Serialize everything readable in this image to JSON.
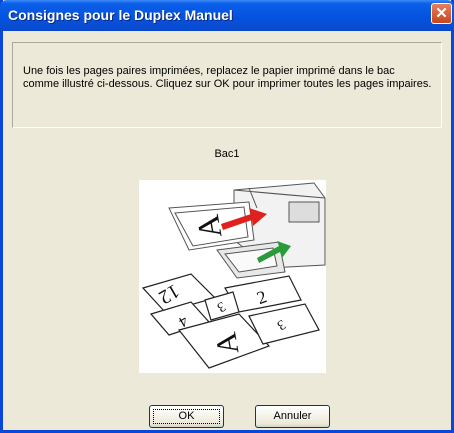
{
  "window": {
    "title": "Consignes pour le Duplex Manuel"
  },
  "message": "Une fois les pages paires imprimées, replacez le papier imprimé dans le bac comme illustré ci-dessous. Cliquez sur OK pour imprimer toutes les pages impaires.",
  "tray_label": "Bac1",
  "buttons": {
    "ok": "OK",
    "cancel": "Annuler"
  },
  "illustration": {
    "page_labels": [
      "A",
      "1",
      "2",
      "3",
      "4",
      "12"
    ]
  },
  "colors": {
    "titlebar": "#0553e0",
    "dialog_bg": "#ece9d8",
    "arrow_red": "#e0201c",
    "arrow_green": "#2a9a3a"
  }
}
